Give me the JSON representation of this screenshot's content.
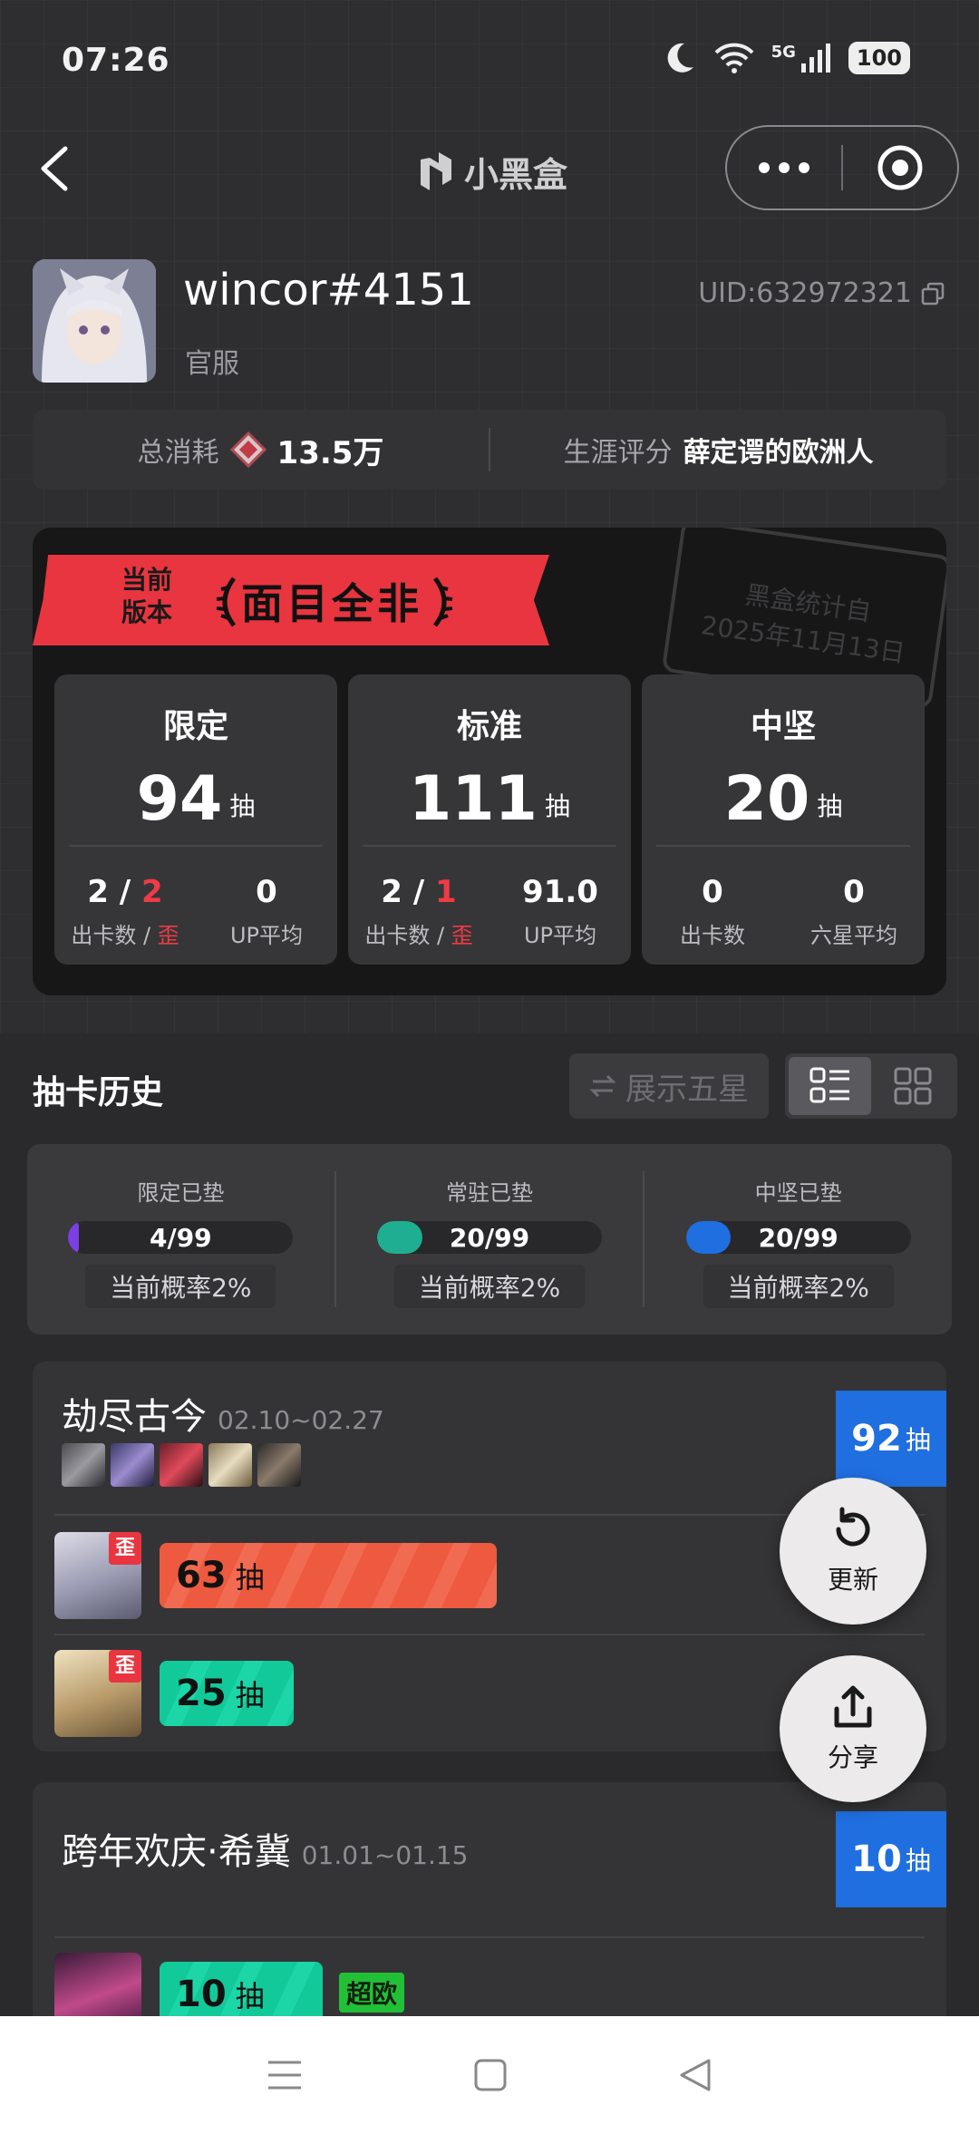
{
  "status_bar": {
    "time": "07:26",
    "network": "5G",
    "battery": "100"
  },
  "nav": {
    "brand": "小黑盒",
    "back_icon": "chevron-left-icon",
    "more_icon": "more-dots-icon",
    "target_icon": "target-icon"
  },
  "profile": {
    "username": "wincor#4151",
    "server": "官服",
    "uid": "UID:632972321",
    "total_label": "总消耗",
    "total_value": "13.5万",
    "rating_label": "生涯评分",
    "rating_value": "薛定谔的欧洲人"
  },
  "version_card": {
    "small_line1": "当前",
    "small_line2": "版本",
    "title": "面目全非",
    "stamp_line1": "黑盒统计自",
    "stamp_line2": "2025年11月13日",
    "pools": [
      {
        "name": "限定",
        "count": "94",
        "unit": "抽",
        "a_value": "2",
        "a_value2": "2",
        "a_label": "出卡数 / ",
        "a_label2": "歪",
        "b_value": "0",
        "b_label": "UP平均"
      },
      {
        "name": "标准",
        "count": "111",
        "unit": "抽",
        "a_value": "2",
        "a_value2": "1",
        "a_label": "出卡数 / ",
        "a_label2": "歪",
        "b_value": "91.0",
        "b_label": "UP平均"
      },
      {
        "name": "中坚",
        "count": "20",
        "unit": "抽",
        "a_value": "0",
        "a_label": "出卡数",
        "b_value": "0",
        "b_label": "六星平均"
      }
    ]
  },
  "history": {
    "title": "抽卡历史",
    "toggle_label": "展示五星",
    "pity": [
      {
        "label": "限定已垫",
        "value": "4/99",
        "progress": 0.04,
        "color": "#7b3fe4",
        "prob": "当前概率2%"
      },
      {
        "label": "常驻已垫",
        "value": "20/99",
        "progress": 0.2,
        "color": "#1fae92",
        "prob": "当前概率2%"
      },
      {
        "label": "中坚已垫",
        "value": "20/99",
        "progress": 0.2,
        "color": "#1f6fe0",
        "prob": "当前概率2%"
      }
    ],
    "banners": [
      {
        "name": "劫尽古今",
        "dates": "02.10~02.27",
        "total": "92",
        "unit": "抽",
        "pulls": [
          {
            "count": "63",
            "unit": "抽",
            "badge": "歪",
            "fraction": 0.63
          },
          {
            "count": "25",
            "unit": "抽",
            "badge": "歪",
            "fraction": 0.25
          }
        ]
      },
      {
        "name": "跨年欢庆·希冀",
        "dates": "01.01~01.15",
        "total": "10",
        "unit": "抽",
        "pulls": [
          {
            "count": "10",
            "unit": "抽",
            "tag": "超欧",
            "fraction": 0.1
          }
        ]
      }
    ]
  },
  "fabs": {
    "refresh": "更新",
    "share": "分享"
  },
  "colors": {
    "accent_red": "#e8353f",
    "accent_blue": "#1f6fe0",
    "green": "#12c99a"
  }
}
